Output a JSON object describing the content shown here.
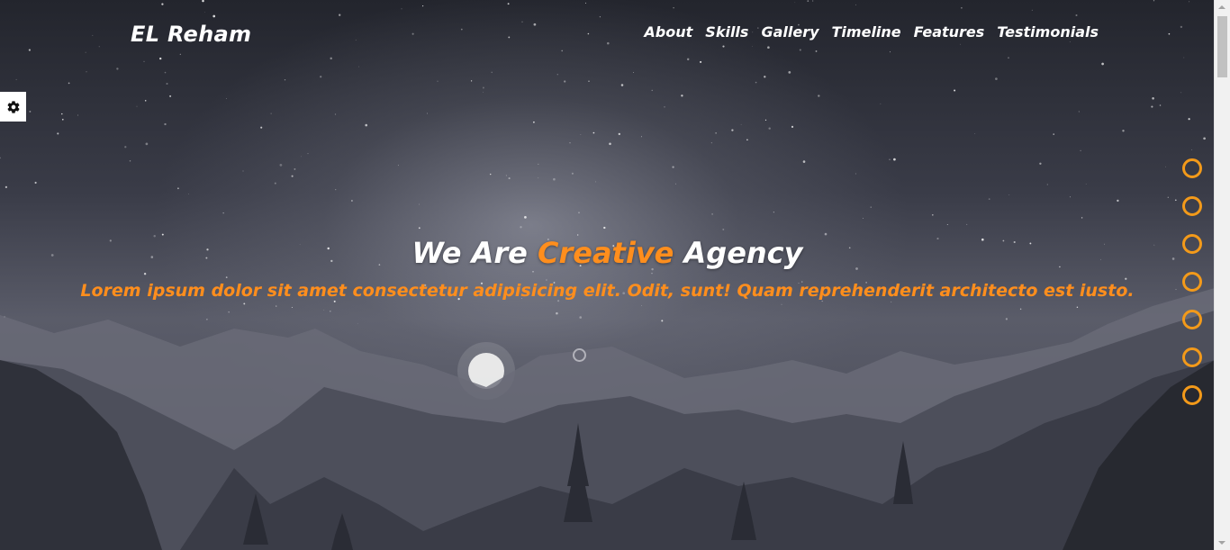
{
  "header": {
    "logo": "EL Reham",
    "nav": [
      "About",
      "Skills",
      "Gallery",
      "Timeline",
      "Features",
      "Testimonials"
    ]
  },
  "settings": {
    "icon": "gear-icon"
  },
  "hero": {
    "title_prefix": "We Are ",
    "title_accent": "Creative",
    "title_suffix": " Agency",
    "subtitle": "Lorem ipsum dolor sit amet consectetur adipisicing elit. Odit, sunt! Quam reprehenderit architecto est iusto."
  },
  "bullets": {
    "count": 7
  },
  "colors": {
    "accent": "#ff8e1d",
    "bullet": "#f39a1a",
    "text": "#ffffff"
  }
}
